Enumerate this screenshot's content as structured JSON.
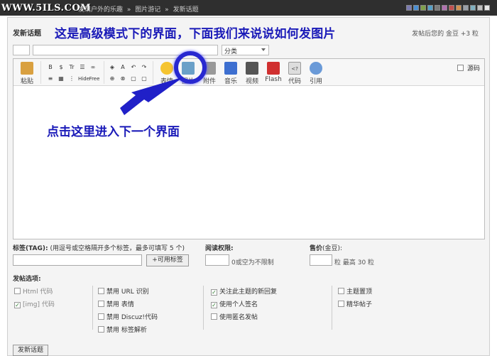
{
  "logo": "WWW.5ILS.COM",
  "breadcrumb": [
    "发现户外的乐趣",
    "»",
    "图片游记",
    "»",
    "发新话题"
  ],
  "skin_colors": [
    "#7b7bb0",
    "#4a8fd4",
    "#7fa04a",
    "#55a0c8",
    "#7a7a7a",
    "#b070b0",
    "#c05050",
    "#d09050",
    "#9aa0a8",
    "#80b0c0",
    "#c0c0c0",
    "#e8e8e8"
  ],
  "page_title": "发新话题",
  "reward_note": "发帖后您的 金豆 +3 粒",
  "annotations": {
    "top": "这是高级模式下的界面，下面我们来说说如何发图片",
    "bottom": "点击这里进入下一个界面"
  },
  "category": {
    "selected": "分类"
  },
  "toolbar": {
    "paste": "粘贴",
    "big": [
      {
        "label": "表情",
        "icon": "smiley-icon",
        "color": "#f5c430"
      },
      {
        "label": "图片",
        "icon": "image-icon",
        "color": "#6aa0c8"
      },
      {
        "label": "附件",
        "icon": "attachment-icon",
        "color": "#999999"
      },
      {
        "label": "音乐",
        "icon": "music-icon",
        "color": "#3d6fd0"
      },
      {
        "label": "视频",
        "icon": "video-icon",
        "color": "#555555"
      },
      {
        "label": "Flash",
        "icon": "flash-icon",
        "color": "#d03030"
      },
      {
        "label": "代码",
        "icon": "code-icon",
        "color": "#dddddd"
      },
      {
        "label": "引用",
        "icon": "quote-icon",
        "color": "#6a9ad8"
      }
    ],
    "source_mode": "源码",
    "format_row1": [
      "B",
      "$",
      "Tr",
      "☰",
      "∞"
    ],
    "format_row2": [
      "≡",
      "▦",
      "⋮",
      "Hide",
      "Free"
    ],
    "misc_row1": [
      "◈",
      "A",
      "↶",
      "↷"
    ],
    "misc_row2": [
      "⊕",
      "⊗",
      "▢",
      "▢"
    ],
    "code_icon_text": "<?"
  },
  "tags": {
    "label": "标签(TAG):",
    "hint": "(用逗号或空格隔开多个标签，最多可填写 5 个)",
    "button": "+可用标签"
  },
  "read_permission": {
    "label": "阅读权限:",
    "hint": "0或空为不限制"
  },
  "price": {
    "label": "售价",
    "unit_label": "(金豆):",
    "max": "粒 最高 30 粒"
  },
  "post_options": {
    "label": "发帖选项:",
    "col1": [
      {
        "label": "Html 代码",
        "checked": false,
        "disabled": true
      },
      {
        "label": "[img] 代码",
        "checked": true,
        "disabled": true
      }
    ],
    "col2": [
      {
        "label": "禁用 URL 识别",
        "checked": false
      },
      {
        "label": "禁用 表情",
        "checked": false
      },
      {
        "label": "禁用 Discuz!代码",
        "checked": false
      },
      {
        "label": "禁用 标签解析",
        "checked": false
      }
    ],
    "col3": [
      {
        "label": "关注此主题的新回复",
        "checked": true
      },
      {
        "label": "使用个人签名",
        "checked": true
      },
      {
        "label": "使用匿名发帖",
        "checked": false
      }
    ],
    "col4": [
      {
        "label": "主题置顶",
        "checked": false
      },
      {
        "label": "精华帖子",
        "checked": false
      }
    ]
  },
  "submit": "发新话题"
}
